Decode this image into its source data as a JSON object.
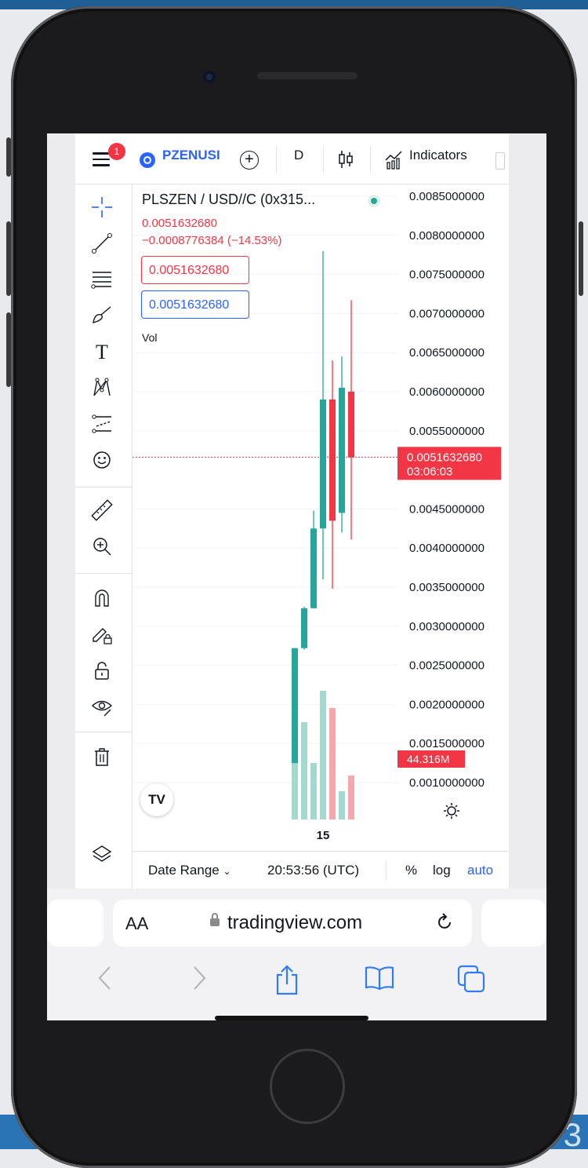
{
  "slide_number": "3",
  "topbar": {
    "notification_count": "1",
    "symbol": "PZENUSI",
    "interval": "D",
    "indicators_label": "Indicators"
  },
  "chart": {
    "title": "PLSZEN / USD//C (0x315...",
    "last_price": "0.0051632680",
    "change": "−0.0008776384 (−14.53%)",
    "sell_price": "0.0051632680",
    "buy_price": "0.0051632680",
    "volume_label": "Vol",
    "price_tag": "0.0051632680",
    "countdown": "03:06:03",
    "volume_tag": "44.316M",
    "x_tick": "15",
    "logo_text": "TV"
  },
  "chart_data": {
    "type": "candlestick",
    "y_axis_labels": [
      "0.0085000000",
      "0.0080000000",
      "0.0075000000",
      "0.0070000000",
      "0.0065000000",
      "0.0060000000",
      "0.0055000000",
      "0.0045000000",
      "0.0040000000",
      "0.0035000000",
      "0.0030000000",
      "0.0025000000",
      "0.0020000000",
      "0.0015000000",
      "0.0010000000"
    ],
    "ylim": [
      0.0007,
      0.0085
    ],
    "candles": [
      {
        "open": 0.00125,
        "close": 0.00272,
        "high": 0.00272,
        "low": 0.00125,
        "color": "up"
      },
      {
        "open": 0.00272,
        "close": 0.00323,
        "high": 0.00325,
        "low": 0.0027,
        "color": "up"
      },
      {
        "open": 0.00323,
        "close": 0.00425,
        "high": 0.00448,
        "low": 0.0037,
        "color": "up"
      },
      {
        "open": 0.00425,
        "close": 0.0059,
        "high": 0.0078,
        "low": 0.0036,
        "color": "up"
      },
      {
        "open": 0.0059,
        "close": 0.00435,
        "high": 0.0064,
        "low": 0.00348,
        "color": "down"
      },
      {
        "open": 0.00445,
        "close": 0.00605,
        "high": 0.00645,
        "low": 0.0042,
        "color": "up"
      },
      {
        "open": 0.006,
        "close": 0.00516,
        "high": 0.00717,
        "low": 0.00411,
        "color": "down"
      }
    ],
    "volumes": [
      0.38,
      0.62,
      0.36,
      0.82,
      0.71,
      0.18,
      0.28
    ],
    "current_price": 0.005163268
  },
  "bottombar": {
    "date_range": "Date Range",
    "time": "20:53:56 (UTC)",
    "percent": "%",
    "log": "log",
    "auto": "auto"
  },
  "browser": {
    "aa_label": "AA",
    "url": "tradingview.com"
  },
  "colors": {
    "up": "#26a69a",
    "down": "#f23645",
    "up_volume": "#a6d8d2",
    "down_volume": "#f4a8ad",
    "accent": "#2962ff"
  }
}
